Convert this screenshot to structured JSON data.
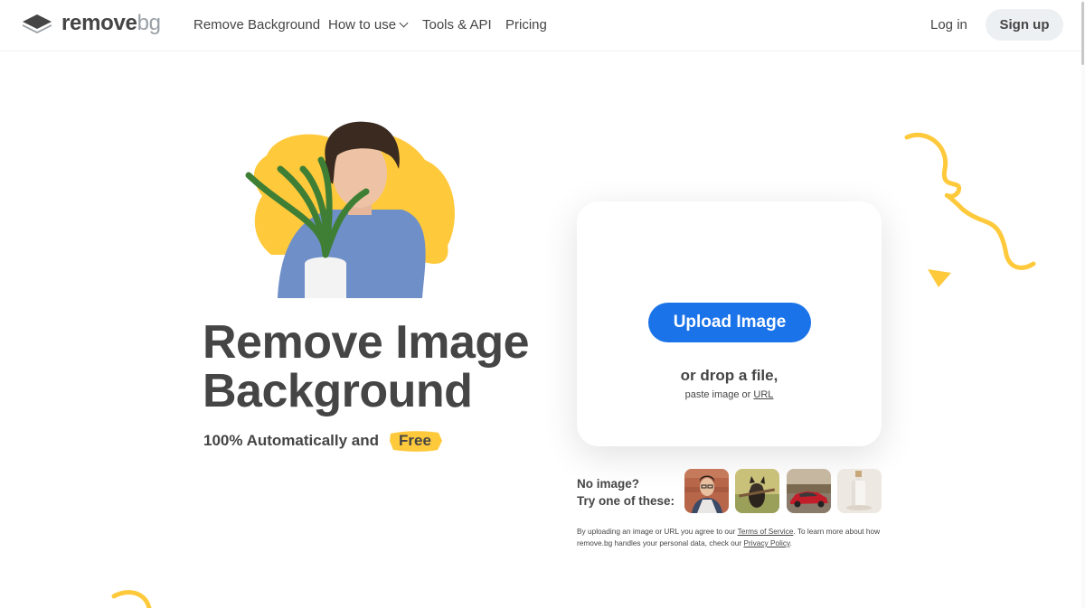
{
  "nav": {
    "logo_main": "remove",
    "logo_bg": "bg",
    "links": [
      "Remove Background",
      "How to use",
      "Tools & API",
      "Pricing"
    ],
    "login": "Log in",
    "signup": "Sign up"
  },
  "hero": {
    "title_line1": "Remove Image",
    "title_line2": "Background",
    "subtitle": "100% Automatically and",
    "free": "Free"
  },
  "upload": {
    "button": "Upload Image",
    "drop": "or drop a file,",
    "paste": "paste image or",
    "url": "URL"
  },
  "samples": {
    "line1": "No image?",
    "line2": "Try one of these:",
    "thumbnails": [
      "man-portrait-thumbnail",
      "dog-thumbnail",
      "car-thumbnail",
      "bottle-thumbnail"
    ]
  },
  "legal": {
    "pre": "By uploading an image or URL you agree to our",
    "tos": "Terms of Service",
    "mid": ". To learn more about how remove.bg handles your personal data, check our",
    "privacy": "Privacy Policy",
    "end": "."
  },
  "colors": {
    "accent_blue": "#1a73e8",
    "accent_yellow": "#ffc93c",
    "text": "#454545"
  }
}
